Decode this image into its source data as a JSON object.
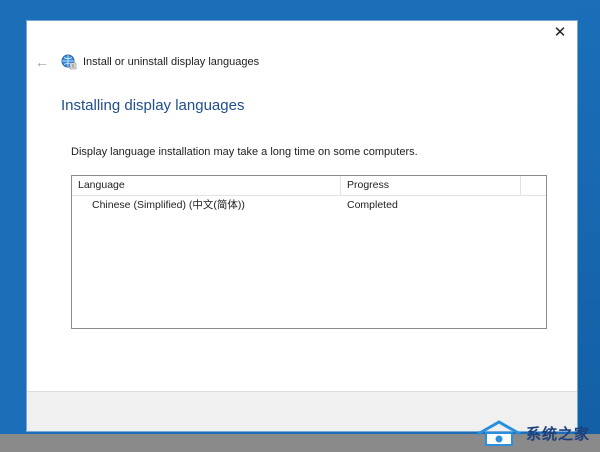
{
  "window": {
    "title": "Install or uninstall display languages",
    "close_symbol": "✕",
    "back_symbol": "←"
  },
  "page": {
    "title": "Installing display languages",
    "description": "Display language installation may take a long time on some computers."
  },
  "list": {
    "columns": [
      "Language",
      "Progress"
    ],
    "rows": [
      {
        "language": "Chinese (Simplified) (中文(简体))",
        "progress": "Completed"
      }
    ]
  },
  "watermark": {
    "text": "系统之家"
  },
  "colors": {
    "accent_blue": "#1f4e8c",
    "desktop_blue": "#1a6fb8"
  },
  "icons": {
    "back": "back-arrow-icon",
    "app": "globe-languages-icon",
    "close": "close-icon"
  }
}
